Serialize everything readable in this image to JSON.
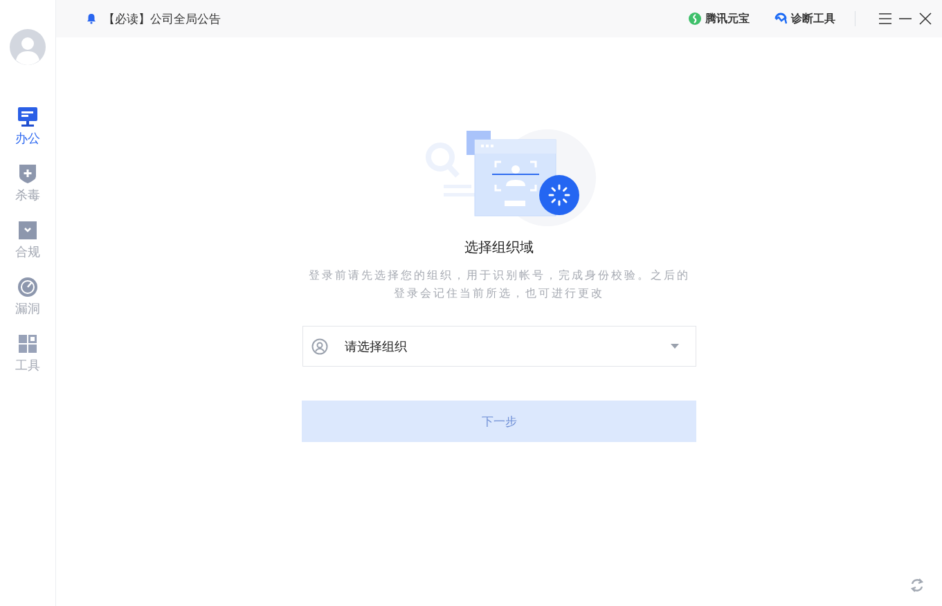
{
  "topbar": {
    "announcement": "【必读】公司全局公告",
    "links": [
      {
        "kind": "yuanbao",
        "label": "腾讯元宝"
      },
      {
        "kind": "diagnose",
        "label": "诊断工具"
      }
    ]
  },
  "sidebar": {
    "items": [
      {
        "kind": "office",
        "label": "办公",
        "selected": true
      },
      {
        "kind": "antivirus",
        "label": "杀毒",
        "selected": false
      },
      {
        "kind": "compliance",
        "label": "合规",
        "selected": false
      },
      {
        "kind": "vulnerability",
        "label": "漏洞",
        "selected": false
      },
      {
        "kind": "tools",
        "label": "工具",
        "selected": false
      }
    ]
  },
  "main": {
    "title": "选择组织域",
    "description": "登录前请先选择您的组织，用于识别帐号，完成身份校验。之后的登录会记住当前所选，也可进行更改",
    "org_select": {
      "placeholder": "请选择组织"
    },
    "next_button": {
      "label": "下一步",
      "disabled": true
    }
  }
}
